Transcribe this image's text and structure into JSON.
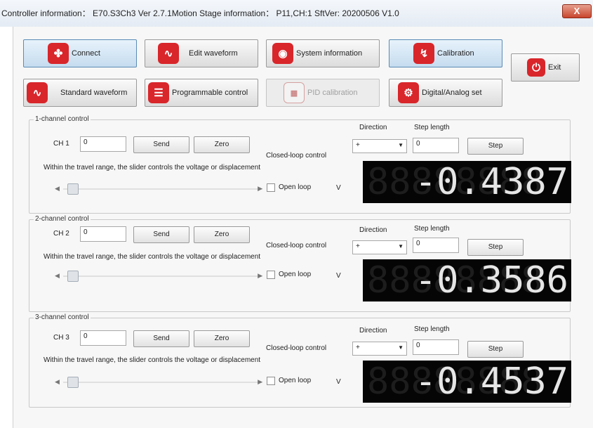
{
  "window": {
    "title": "Controller information： E70.S3Ch3  Ver  2.7.1Motion Stage information： P11,CH:1  SftVer: 20200506 V1.0",
    "close_glyph": "X"
  },
  "toolbar": {
    "connect": "Connect",
    "edit_waveform": "Edit waveform",
    "system_information": "System information",
    "calibration": "Calibration",
    "exit": "Exit",
    "standard_waveform": "Standard waveform",
    "programmable_control": "Programmable control",
    "pid_calibration": "PID calibration",
    "digital_analog_set": "Digital/Analog set"
  },
  "channels": [
    {
      "group_label": "1-channel control",
      "ch_label": "CH 1",
      "ch_value": "0",
      "send": "Send",
      "zero": "Zero",
      "closed_loop": "Closed-loop control",
      "hint": "Within the travel range, the slider controls the voltage or displacement",
      "open_loop": "Open loop",
      "unit": "V",
      "direction_label": "Direction",
      "direction_value": "+",
      "step_length_label": "Step length",
      "step_value": "0",
      "step": "Step",
      "display_ghost": "88888888",
      "display_value": "-0.4387"
    },
    {
      "group_label": "2-channel control",
      "ch_label": "CH 2",
      "ch_value": "0",
      "send": "Send",
      "zero": "Zero",
      "closed_loop": "Closed-loop control",
      "hint": "Within the travel range, the slider controls the voltage or displacement",
      "open_loop": "Open loop",
      "unit": "V",
      "direction_label": "Direction",
      "direction_value": "+",
      "step_length_label": "Step length",
      "step_value": "0",
      "step": "Step",
      "display_ghost": "88888888",
      "display_value": "-0.3586"
    },
    {
      "group_label": "3-channel control",
      "ch_label": "CH 3",
      "ch_value": "0",
      "send": "Send",
      "zero": "Zero",
      "closed_loop": "Closed-loop control",
      "hint": "Within the travel range, the slider controls the voltage or displacement",
      "open_loop": "Open loop",
      "unit": "V",
      "direction_label": "Direction",
      "direction_value": "+",
      "step_length_label": "Step length",
      "step_value": "0",
      "step": "Step",
      "display_ghost": "88888888",
      "display_value": "-0.4537"
    }
  ],
  "colors": {
    "icon_red": "#d8262b",
    "selected_button": "#c5dcef",
    "display_bg": "#050505"
  }
}
